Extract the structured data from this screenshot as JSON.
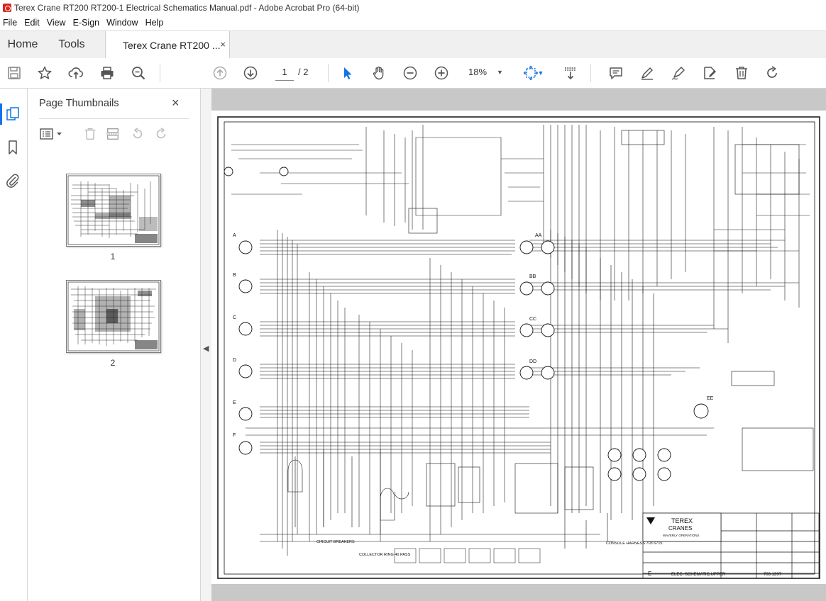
{
  "window": {
    "title": "Terex Crane RT200 RT200-1 Electrical Schematics Manual.pdf - Adobe Acrobat Pro (64-bit)"
  },
  "menu": {
    "items": [
      "File",
      "Edit",
      "View",
      "E-Sign",
      "Window",
      "Help"
    ]
  },
  "tabs": {
    "home": "Home",
    "tools": "Tools",
    "document": "Terex Crane RT200 ...",
    "close": "×"
  },
  "toolbar": {
    "icons": [
      "save-icon",
      "bookmark-star-icon",
      "upload-cloud-icon",
      "print-icon",
      "search-zoom-icon",
      "page-up-icon",
      "page-down-icon",
      "select-pointer-icon",
      "hand-tool-icon",
      "zoom-out-icon",
      "zoom-in-icon",
      "fit-page-icon",
      "scroll-mode-icon",
      "comment-icon",
      "highlight-pen-icon",
      "sign-icon",
      "edit-pdf-icon",
      "delete-icon",
      "rotate-icon"
    ],
    "page_current": "1",
    "page_total": "/ 2",
    "zoom": "18%"
  },
  "side_panel": {
    "title": "Page Thumbnails",
    "close": "×",
    "thumbnails": [
      {
        "label": "1"
      },
      {
        "label": "2"
      }
    ]
  },
  "document": {
    "company": "TEREX",
    "company_sub": "CRANES",
    "company_div": "WAVERLY OPERATIONS",
    "drawing_title": "ELEC. SCHEMATIC,UPPER",
    "drawing_number": "703 1397",
    "sheet": "E",
    "circuit_breakers_label": "CIRCUIT BREAKERS",
    "collector_ring_label": "COLLECTOR RING 40 PASS",
    "console_harness_label": "CONSOLE HARNESS 703 6715",
    "connector_labels": [
      "A",
      "B",
      "C",
      "D",
      "E",
      "F"
    ],
    "connector_labels_right": [
      "AA",
      "BB",
      "CC",
      "DD",
      "EE"
    ]
  }
}
